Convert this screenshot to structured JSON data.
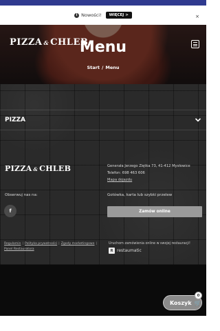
{
  "notice": {
    "text": "Nowości!",
    "more_label": "WIĘCEJ >",
    "close_label": "×"
  },
  "header": {
    "logo_left": "PIZZA",
    "logo_amp": "&",
    "logo_right": "CHLEB",
    "menu_icon": "hamburger-icon"
  },
  "hero": {
    "title": "Menu",
    "breadcrumb": [
      "Start",
      "Menu"
    ],
    "separator": "/"
  },
  "menu": {
    "category": "PIZZA",
    "chevron_icon": "chevron-down-icon"
  },
  "footer": {
    "address": "Generała Jerzego Ziętka 73, 41-412 Mysłowice",
    "phone": "Telefon: 698 463 606",
    "map_link": "Mapa dojazdu",
    "follow_label": "Obserwuj nas na:",
    "facebook_icon": "f",
    "payment": "Gotówka, karta lub szybki przelew",
    "order_button": "Zamów online",
    "legal_links": [
      "Regulamin",
      "Polityka prywatności",
      "Zgody marketingowe",
      "Panel Restauratora"
    ],
    "resto_text": "Uruchom zamówienia online w swojej restauracji!",
    "resto_brand": "restaumatic",
    "resto_mark": "R"
  },
  "cart": {
    "label": "Koszyk",
    "icon": "🛒",
    "count": "0"
  },
  "colors": {
    "notice_border": "#2f3a8f",
    "slate_bg": "#2a2a2a",
    "order_button_bg": "#9a9a9a",
    "cart_bg": "#8b8b8b"
  }
}
